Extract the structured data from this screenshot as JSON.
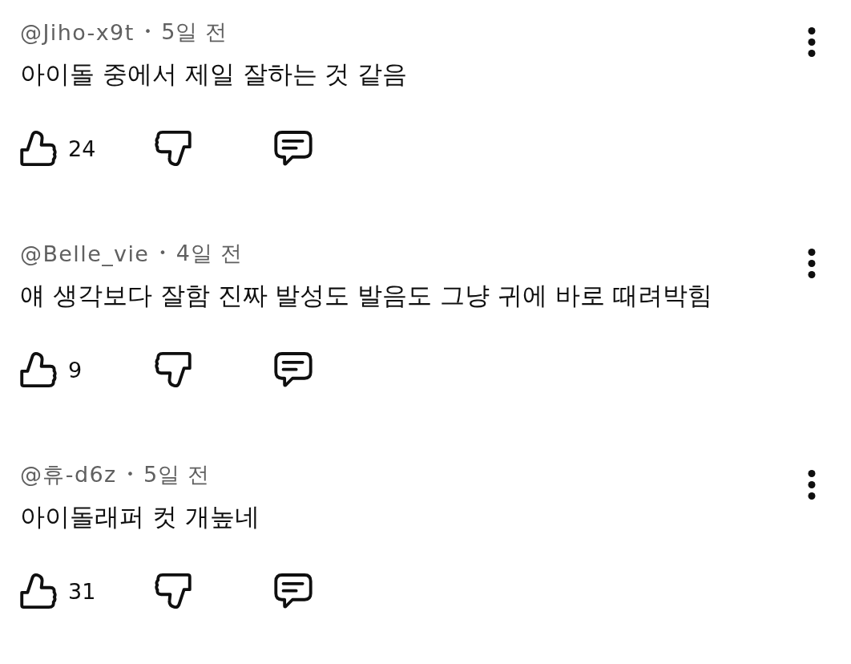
{
  "comments": [
    {
      "author": "@Jiho-x9t",
      "separator": "•",
      "time": "5일 전",
      "text": "아이돌 중에서 제일 잘하는 것 같음",
      "likes": "24"
    },
    {
      "author": "@Belle_vie",
      "separator": "•",
      "time": "4일 전",
      "text": "얘 생각보다 잘함 진짜 발성도 발음도 그냥 귀에 바로 때려박힘",
      "likes": "9"
    },
    {
      "author": "@휴-d6z",
      "separator": "•",
      "time": "5일 전",
      "text": "아이돌래퍼 컷 개높네",
      "likes": "31"
    }
  ]
}
